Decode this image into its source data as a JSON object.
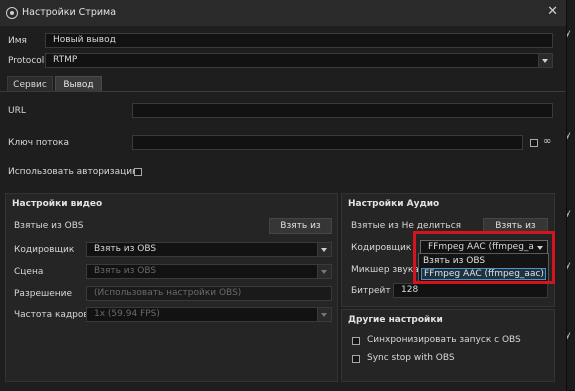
{
  "window": {
    "title": "Настройки Стрима"
  },
  "form": {
    "name_label": "Имя",
    "name_value": "Новый вывод",
    "protocol_label": "Protocol",
    "protocol_value": "RTMP"
  },
  "tabs": [
    "Сервис",
    "Вывод"
  ],
  "service": {
    "url_label": "URL",
    "url_value": "",
    "key_label": "Ключ потока",
    "key_value": "",
    "auth_label": "Использовать авторизацию"
  },
  "video": {
    "title": "Настройки видео",
    "from_obs_label": "Взятые из OBS",
    "take_button": "Взять из",
    "encoder_label": "Кодировщик",
    "encoder_value": "Взять из OBS",
    "scene_label": "Сцена",
    "scene_value": "Взять из OBS",
    "resolution_label": "Разрешение",
    "resolution_value": "(Использовать настройки OBS)",
    "fps_label": "Частота кадров",
    "fps_value": "1x (59.94 FPS)"
  },
  "audio": {
    "title": "Настройки Аудио",
    "from_label": "Взятые из Не делиться",
    "take_button": "Взять из",
    "encoder_label": "Кодировщик",
    "encoder_value": "FFmpeg AAC (ffmpeg_aac)",
    "mixer_label": "Микшер звука",
    "bitrate_label": "Битрейт",
    "bitrate_value": "128"
  },
  "encoder_dropdown": {
    "options": [
      "Взять из OBS",
      "FFmpeg AAC (ffmpeg_aac)"
    ],
    "selected": "FFmpeg AAC (ffmpeg_aac)"
  },
  "other": {
    "title": "Другие настройки",
    "sync_label": "Синхронизировать запуск с OBS",
    "sync_stop_label": "Sync stop with OBS"
  },
  "background": {
    "side_letters": [
      "У",
      "У",
      "У",
      "У",
      "У"
    ]
  },
  "colors": {
    "highlight": "#d3131d",
    "selection_border": "#4b93c5"
  }
}
